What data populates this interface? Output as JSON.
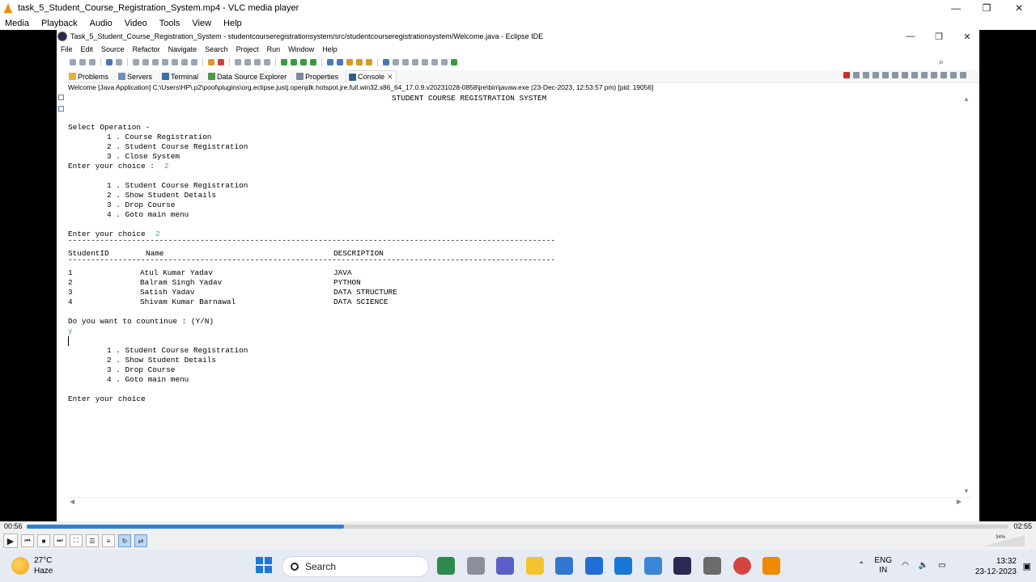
{
  "vlc": {
    "title": "task_5_Student_Course_Registration_System.mp4 - VLC media player",
    "menu": [
      "Media",
      "Playback",
      "Audio",
      "Video",
      "Tools",
      "View",
      "Help"
    ],
    "time_elapsed": "00:56",
    "time_total": "02:55",
    "progress": 0.323,
    "volume_label": "34%",
    "volume_level": 0.34
  },
  "eclipse": {
    "title": "Task_5_Student_Course_Registration_System - studentcourseregistrationsystem/src/studentcourseregistrationsystem/Welcome.java - Eclipse IDE",
    "menu": [
      "File",
      "Edit",
      "Source",
      "Refactor",
      "Navigate",
      "Search",
      "Project",
      "Run",
      "Window",
      "Help"
    ],
    "tabs": [
      {
        "label": "Problems",
        "icon": "problems-icon"
      },
      {
        "label": "Servers",
        "icon": "servers-icon"
      },
      {
        "label": "Terminal",
        "icon": "terminal-icon"
      },
      {
        "label": "Data Source Explorer",
        "icon": "data-source-icon"
      },
      {
        "label": "Properties",
        "icon": "properties-icon"
      },
      {
        "label": "Console",
        "icon": "console-icon",
        "active": true
      }
    ],
    "launch_info": "Welcome [Java Application] C:\\Users\\HP\\.p2\\pool\\plugins\\org.eclipse.justj.openjdk.hotspot.jre.full.win32.x86_64_17.0.9.v20231028-0858\\jre\\bin\\javaw.exe  (23-Dec-2023, 12:53:57 pm) [pid: 19056]"
  },
  "console": {
    "header": "STUDENT COURSE REGISTRATION SYSTEM",
    "select_operation": "Select Operation -",
    "main_menu": [
      "1 . Course Registration",
      "2 . Student Course Registration",
      "3 . Close System"
    ],
    "prompt_choice": "Enter your choice : ",
    "input_1": "2",
    "sub_menu": [
      "1 . Student Course Registration",
      "2 . Show Student Details",
      "3 . Drop Course",
      "4 . Goto main menu"
    ],
    "prompt_choice_2": "Enter your choice ",
    "input_2": "2",
    "divider": "-----------------------------------------------------------------------------------------------------------",
    "table_headers": [
      "StudentID",
      "Name",
      "DESCRIPTION"
    ],
    "students": [
      {
        "id": "1",
        "name": "Atul Kumar Yadav",
        "desc": "JAVA"
      },
      {
        "id": "2",
        "name": "Balram Singh Yadav",
        "desc": "PYTHON"
      },
      {
        "id": "3",
        "name": "Satish Yadav",
        "desc": "DATA STRUCTURE"
      },
      {
        "id": "4",
        "name": "Shivam Kumar Barnawal",
        "desc": "DATA SCIENCE"
      }
    ],
    "continue_prompt": "Do you want to countinue : (Y/N)",
    "input_3": "y",
    "sub_menu_2": [
      "1 . Student Course Registration",
      "2 . Show Student Details",
      "3 . Drop Course",
      "4 . Goto main menu"
    ],
    "final_prompt": "Enter your choice"
  },
  "taskbar": {
    "temperature": "27°C",
    "weather": "Haze",
    "search_label": "Search",
    "lang_top": "ENG",
    "lang_bottom": "IN",
    "time": "13:32",
    "date": "23-12-2023"
  }
}
